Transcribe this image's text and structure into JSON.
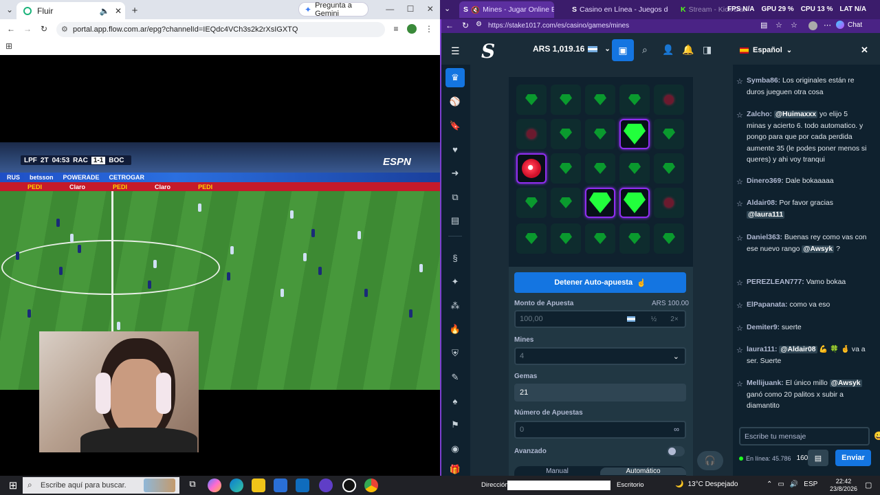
{
  "left_browser": {
    "tab_title": "Fluir",
    "gemini_label": "Pregunta a Gemini",
    "url": "portal.app.flow.com.ar/epg?channelId=IEQdc4VCh3s2k2rXsIGXTQ",
    "scoreboard": {
      "league": "LPF",
      "half": "2T",
      "clock": "04:53",
      "home": "RAC",
      "score": "1-1",
      "away": "BOC"
    },
    "broadcaster": "ESPN",
    "ad_texts": [
      "RUS",
      "betsson",
      "PEDI",
      "Claro",
      "POWERADE",
      "CETROGAR"
    ]
  },
  "right_browser": {
    "tabs": [
      {
        "title": "Mines - Jugar Online Buscam"
      },
      {
        "title": "Casino en Línea - Juegos de Casi"
      },
      {
        "title": "Stream - Kick Dashboard"
      }
    ],
    "stats": {
      "fps": "FPS N/A",
      "gpu": "GPU 29 %",
      "cpu": "CPU 13 %",
      "lat": "LAT N/A"
    },
    "url": "https://stake1017.com/es/casino/games/mines",
    "chat_button": "Chat"
  },
  "stake": {
    "logo": "S",
    "balance": "ARS 1,019.16",
    "grid": [
      [
        "gem",
        "gem",
        "gem",
        "gem",
        "mine"
      ],
      [
        "mine",
        "gem",
        "gem",
        "gem-selected",
        "gem"
      ],
      [
        "mine-selected",
        "gem",
        "gem",
        "gem",
        "gem"
      ],
      [
        "gem",
        "gem",
        "gem-selected",
        "gem-selected",
        "mine"
      ],
      [
        "gem",
        "gem",
        "gem",
        "gem",
        "gem"
      ]
    ],
    "stop_button": "Detener Auto-apuesta",
    "bet_amount_label": "Monto de Apuesta",
    "bet_amount_ars": "ARS 100.00",
    "bet_amount_value": "100,00",
    "half_label": "½",
    "double_label": "2×",
    "mines_label": "Mines",
    "mines_value": "4",
    "gems_label": "Gemas",
    "gems_value": "21",
    "bets_label": "Número de Apuestas",
    "bets_value": "0",
    "advanced_label": "Avanzado",
    "mode_manual": "Manual",
    "mode_auto": "Automático"
  },
  "chat": {
    "language": "Español",
    "messages": [
      {
        "user": "Symba86:",
        "text": " Los originales están re duros jueguen otra cosa"
      },
      {
        "user": "Zalcho:",
        "mention": "@Huimaxxx",
        "text": " yo elijo 5 minas y acierto 6. todo automatico. y pongo para que por cada perdida aumente 35 (le podes poner menos si queres) y ahi voy tranqui"
      },
      {
        "user": "Dinero369:",
        "text": " Dale bokaaaaa"
      },
      {
        "user": "Aldair08:",
        "text": " Por favor gracias ",
        "mention": "@laura111"
      },
      {
        "user": "Daniel363:",
        "text": " Buenas rey como vas con ese nuevo rango ",
        "mention": "@Awsyk",
        "text2": " ?"
      },
      {
        "user": "PEREZLEAN777:",
        "text": " Vamo bokaa"
      },
      {
        "user": "ElPapanata:",
        "text": " como va eso"
      },
      {
        "user": "Demiter9:",
        "text": " suerte"
      },
      {
        "user": "laura111:",
        "mention": "@Aldair08",
        "text": " 💪 🍀 🤞 va a ser. Suerte"
      },
      {
        "user": "Mellijuank:",
        "text": " El único millo ",
        "mention": "@Awsyk",
        "text2": " ganó como 20 palitos x subir a diamantito"
      }
    ],
    "input_placeholder": "Escribe tu mensaje",
    "online_label": "En línea: 45.786",
    "online_count": "160",
    "send_label": "Enviar"
  },
  "taskbar": {
    "search_placeholder": "Escribe aquí para buscar.",
    "direccion_label": "Dirección",
    "escritorio_label": "Escritorio",
    "weather": "13°C  Despejado",
    "lang": "ESP",
    "time": "22:42",
    "date": "23/8/2026"
  },
  "colors": {
    "stake_bg": "#1a2c38",
    "stake_dark": "#0f212e",
    "stake_blue": "#1475e1",
    "gem_green": "#22ff3c",
    "selected_border": "#8f2ef0",
    "browser_purple": "#3b1c6b"
  }
}
